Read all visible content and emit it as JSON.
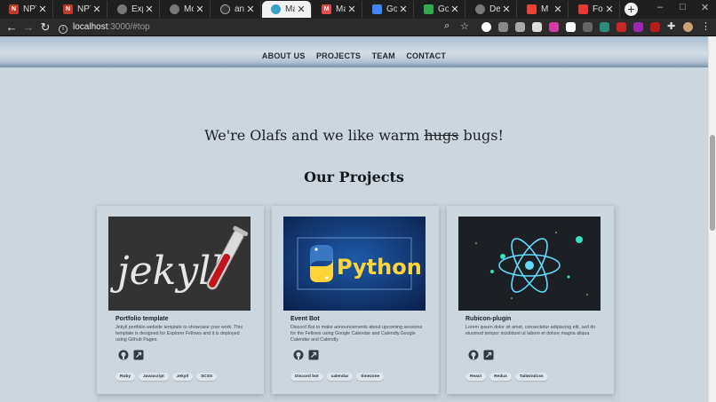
{
  "browser": {
    "tabs": [
      {
        "title": "NPTEL",
        "favicon_color": "#c0392b",
        "active": false
      },
      {
        "title": "NPTEL",
        "favicon_color": "#c0392b",
        "active": false
      },
      {
        "title": "Expe",
        "favicon_color": "#555555",
        "active": false
      },
      {
        "title": "Mod",
        "favicon_color": "#555555",
        "active": false
      },
      {
        "title": "anjali",
        "favicon_color": "#333333",
        "active": false
      },
      {
        "title": "Maje",
        "favicon_color": "#3aa0c8",
        "active": true
      },
      {
        "title": "Majo",
        "favicon_color": "#e24b4b",
        "active": false
      },
      {
        "title": "Goo",
        "favicon_color": "#4285f4",
        "active": false
      },
      {
        "title": "Goo",
        "favicon_color": "#34a853",
        "active": false
      },
      {
        "title": "Devi",
        "favicon_color": "#555555",
        "active": false
      },
      {
        "title": "M",
        "favicon_color": "#ea4335",
        "active": false
      },
      {
        "title": "Form",
        "favicon_color": "#e53935",
        "active": false
      }
    ],
    "address": {
      "host": "localhost",
      "path": ":3000/#top"
    }
  },
  "nav": {
    "items": [
      "ABOUT US",
      "PROJECTS",
      "TEAM",
      "CONTACT"
    ]
  },
  "tagline": {
    "before": "We're Olafs and we like warm ",
    "struck": "hugs",
    "after": " bugs!"
  },
  "projects": {
    "heading": "Our Projects",
    "cards": [
      {
        "image": "jekyll-logo",
        "title": "Portfolio template",
        "description": "Jekyll portfolio website template to showcase your work. This template is designed for Explorer Fellows and it is deployed using Github Pages.",
        "tags": [
          "Ruby",
          "Javascript",
          "Jekyll",
          "SCSS"
        ]
      },
      {
        "image": "python-logo",
        "title": "Event Bot",
        "description": "Discord Bot to make announcements about upcoming sessions for the Fellows using Google Calendar and Calendly.Google Calendar and Calendly",
        "tags": [
          "Discord bot",
          "calendar",
          "timezone"
        ]
      },
      {
        "image": "react-atom",
        "title": "Rubicon-plugin",
        "description": "Lorem ipsum dolor sit amet, consectetur adipiscing elit, sed do eiusmod tempor incididunt ut labore et dolore magna aliqua.",
        "tags": [
          "React",
          "Redux",
          "Tailwindcss"
        ]
      }
    ]
  },
  "icons": {
    "repo": "github-icon",
    "demo": "external-link-icon"
  },
  "colors": {
    "page_bg": "#ccd6de",
    "heading": "#15191d",
    "python_yellow": "#ffd43b",
    "react_cyan": "#61dafb"
  }
}
